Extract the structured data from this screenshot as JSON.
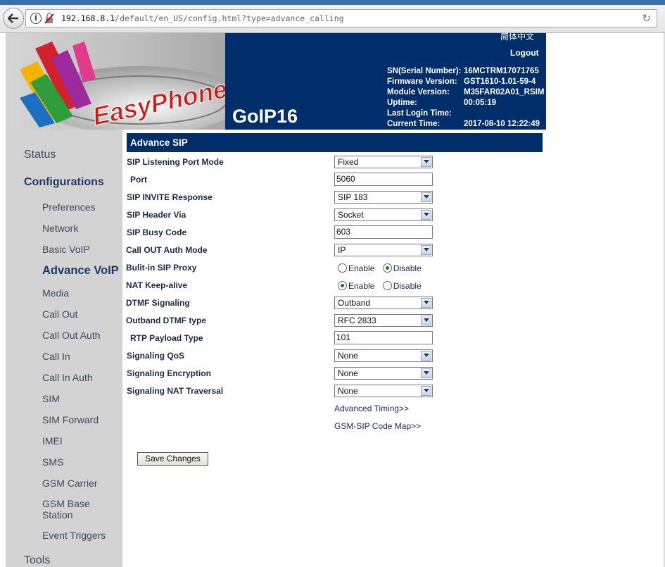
{
  "browser": {
    "url_host": "192.168.8.1",
    "url_path": "/default/en_US/config.html?type=advance_calling"
  },
  "header": {
    "logo_text": "EasyPhone",
    "model": "GoIP16",
    "language_link": "简体中文",
    "logout": "Logout",
    "info": [
      {
        "label": "SN(Serial Number):",
        "value": "16MCTRM17071765"
      },
      {
        "label": "Firmware Version:",
        "value": "GST1610-1.01-59-4"
      },
      {
        "label": "Module Version:",
        "value": "M35FAR02A01_RSIM"
      },
      {
        "label": "Uptime:",
        "value": "00:05:19"
      },
      {
        "label": "Last Login Time:",
        "value": ""
      },
      {
        "label": "Current Time:",
        "value": "2017-08-10 12:22:49"
      }
    ]
  },
  "sidebar": {
    "status": "Status",
    "configurations": "Configurations",
    "items": [
      "Preferences",
      "Network",
      "Basic VoIP",
      "Advance VoIP",
      "Media",
      "Call Out",
      "Call Out Auth",
      "Call In",
      "Call In Auth",
      "SIM",
      "SIM Forward",
      "IMEI",
      "SMS",
      "GSM Carrier",
      "GSM Base Station",
      "Event Triggers"
    ],
    "active_item": "Advance VoIP",
    "tools": "Tools"
  },
  "main": {
    "section_title": "Advance SIP",
    "fields": {
      "sip_listening_port_mode": {
        "label": "SIP Listening Port Mode",
        "value": "Fixed"
      },
      "port": {
        "label": "Port",
        "value": "5060"
      },
      "sip_invite_response": {
        "label": "SIP INVITE Response",
        "value": "SIP 183"
      },
      "sip_header_via": {
        "label": "SIP Header Via",
        "value": "Socket"
      },
      "sip_busy_code": {
        "label": "SIP Busy Code",
        "value": "603"
      },
      "call_out_auth_mode": {
        "label": "Call OUT Auth Mode",
        "value": "IP"
      },
      "builtin_sip_proxy": {
        "label": "Bulit-in SIP Proxy",
        "enable": "Enable",
        "disable": "Disable",
        "selected": "Disable"
      },
      "nat_keep_alive": {
        "label": "NAT Keep-alive",
        "enable": "Enable",
        "disable": "Disable",
        "selected": "Enable"
      },
      "dtmf_signaling": {
        "label": "DTMF Signaling",
        "value": "Outband"
      },
      "outband_dtmf_type": {
        "label": "Outband DTMF type",
        "value": "RFC 2833"
      },
      "rtp_payload_type": {
        "label": "RTP Payload Type",
        "value": "101"
      },
      "signaling_qos": {
        "label": "Signaling QoS",
        "value": "None"
      },
      "signaling_encryption": {
        "label": "Signaling Encryption",
        "value": "None"
      },
      "signaling_nat_traversal": {
        "label": "Signaling NAT Traversal",
        "value": "None"
      }
    },
    "advanced_timing_link": "Advanced Timing>>",
    "code_map_link": "GSM-SIP Code Map>>",
    "save_button": "Save Changes"
  },
  "colors": {
    "header_bg": "#002e6b",
    "sidebar_bg": "#d3d3d3",
    "label_text": "#1a2a44"
  }
}
